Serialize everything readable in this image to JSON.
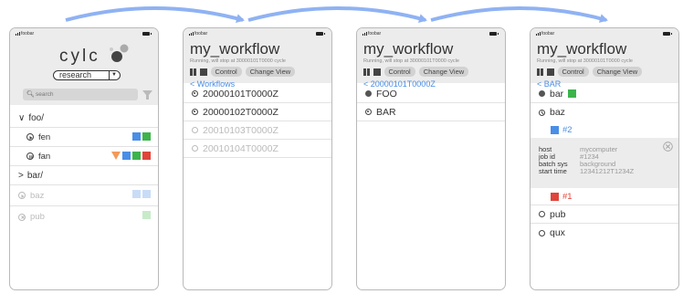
{
  "status": {
    "carrier": "foobar"
  },
  "arrow_color": "#8fb2f3",
  "s1": {
    "logo": "cylc",
    "suite_select": "research",
    "search_placeholder": "search",
    "rows": [
      {
        "label": "foo/",
        "prefix": "∨",
        "dim": false
      },
      {
        "label": "fen",
        "icon": "play",
        "squares": [
          "blue",
          "green"
        ]
      },
      {
        "label": "fan",
        "icon": "pause",
        "warn": true,
        "squares": [
          "blue",
          "green",
          "red"
        ]
      },
      {
        "label": "bar/",
        "prefix": ">",
        "dim": false
      },
      {
        "label": "baz",
        "icon": "play",
        "dim": true,
        "squares": [
          "lblue",
          "lblue"
        ]
      },
      {
        "label": "pub",
        "icon": "x",
        "dim": true,
        "squares": [
          "lgreen"
        ]
      }
    ]
  },
  "s2": {
    "title": "my_workflow",
    "subtitle": "Running, will stop at 30000101T0000 cycle",
    "control": "Control",
    "change_view": "Change View",
    "back": "< Workflows",
    "rows": [
      "20000101T0000Z",
      "20000102T0000Z",
      "20010103T0000Z",
      "20010104T0000Z"
    ]
  },
  "s3": {
    "title": "my_workflow",
    "subtitle": "Running, will stop at 30000101T0000 cycle",
    "control": "Control",
    "change_view": "Change View",
    "back": "< 20000101T0000Z",
    "rows": [
      "FOO",
      "BAR"
    ]
  },
  "s4": {
    "title": "my_workflow",
    "subtitle": "Running, will stop at 30000101T0000 cycle",
    "control": "Control",
    "change_view": "Change View",
    "back": "< BAR",
    "rows": [
      "bar",
      "baz",
      "#2",
      "#1",
      "pub",
      "qux"
    ],
    "detail": {
      "host_k": "host",
      "host_v": "mycomputer",
      "jobid_k": "job id",
      "jobid_v": "#1234",
      "batch_k": "batch sys",
      "batch_v": "background",
      "start_k": "start time",
      "start_v": "12341212T1234Z"
    }
  }
}
